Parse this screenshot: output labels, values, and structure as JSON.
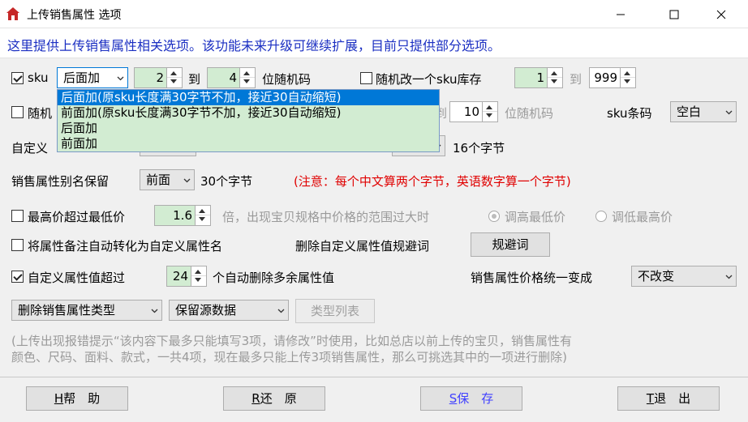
{
  "window": {
    "title": "上传销售属性 选项"
  },
  "info_text": "这里提供上传销售属性相关选项。该功能未来升级可继续扩展，目前只提供部分选项。",
  "row1": {
    "sku_label": "sku",
    "sku_position_select": "后面加",
    "from_value": "2",
    "to_label": "到",
    "to_value": "4",
    "suffix_label": "位随机码",
    "random_stock_label": "随机改一个sku库存",
    "stock_from": "1",
    "stock_to_label": "到",
    "stock_to": "999"
  },
  "dropdown": {
    "options": [
      "后面加(原sku长度满30字节不加，接近30自动缩短)",
      "前面加(原sku长度满30字节不加，接近30自动缩短)",
      "后面加",
      "前面加"
    ]
  },
  "row2": {
    "random_label": "随机",
    "to_label": "到",
    "to_value": "10",
    "suffix_label": "位随机码",
    "barcode_label": "sku条码",
    "barcode_select": "空白"
  },
  "row3": {
    "custom_label": "自定义",
    "bytes_label": "16个字节"
  },
  "row4": {
    "alias_label": "销售属性别名保留",
    "alias_select": "前面",
    "bytes_label": "30个字节",
    "note": "(注意：每个中文算两个字节，英语数字算一个字节)"
  },
  "row5": {
    "max_price_label": "最高价超过最低价",
    "multiplier": "1.6",
    "desc": "倍，出现宝贝规格中价格的范围过大时",
    "radio_raise": "调高最低价",
    "radio_lower": "调低最高价"
  },
  "row6": {
    "convert_label": "将属性备注自动转化为自定义属性名",
    "remove_label": "删除自定义属性值规避词",
    "avoid_button": "规避词"
  },
  "row7": {
    "exceed_label": "自定义属性值超过",
    "exceed_value": "24",
    "exceed_suffix": "个自动删除多余属性值",
    "unify_label": "销售属性价格统一变成",
    "unify_select": "不改变"
  },
  "row8": {
    "delete_type_select": "删除销售属性类型",
    "keep_source_select": "保留源数据",
    "type_list_button": "类型列表"
  },
  "help_text_1": "(上传出现报错提示“该内容下最多只能填写3项，请修改”时使用，比如总店以前上传的宝贝，销售属性有",
  "help_text_2": "颜色、尺码、面料、款式，一共4项，现在最多只能上传3项销售属性，那么可挑选其中的一项进行删除)",
  "footer": {
    "help_key": "H",
    "help_label": "帮　助",
    "restore_key": "R",
    "restore_label": "还　原",
    "save_key": "S",
    "save_label": "保　存",
    "exit_key": "T",
    "exit_label": "退　出"
  },
  "colors": {
    "info_text": "#1b2fc2",
    "note": "#e00000",
    "spin_bg": "#d2ecd2",
    "selected": "#0078d7"
  }
}
